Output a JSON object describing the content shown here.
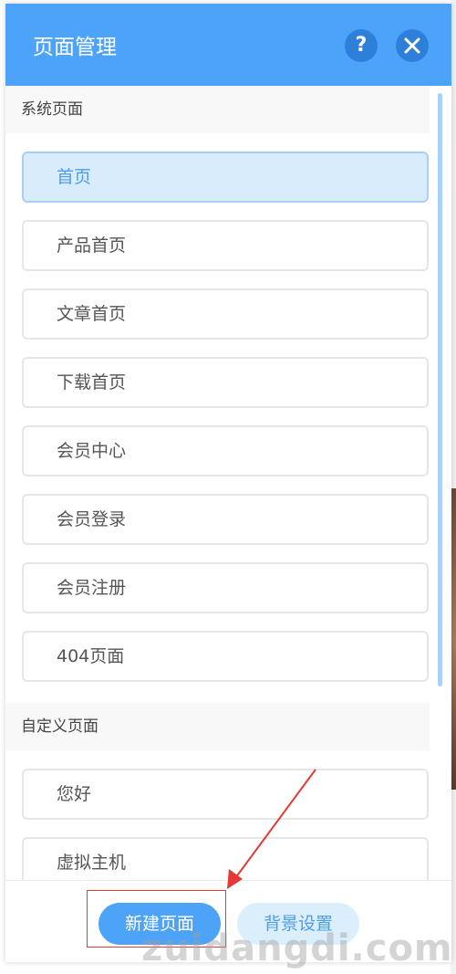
{
  "header": {
    "title": "页面管理",
    "help_symbol": "?",
    "accent_color": "#4da3f8"
  },
  "sections": {
    "system": {
      "title": "系统页面",
      "items": [
        "首页",
        "产品首页",
        "文章首页",
        "下载首页",
        "会员中心",
        "会员登录",
        "会员注册",
        "404页面"
      ],
      "active_item": "首页"
    },
    "custom": {
      "title": "自定义页面",
      "items": [
        "您好",
        "虚拟主机"
      ]
    }
  },
  "footer": {
    "new_page": "新建页面",
    "background_settings": "背景设置"
  },
  "annotation": {
    "highlight_color": "#e53935"
  },
  "watermark": "zuidangdi.com"
}
